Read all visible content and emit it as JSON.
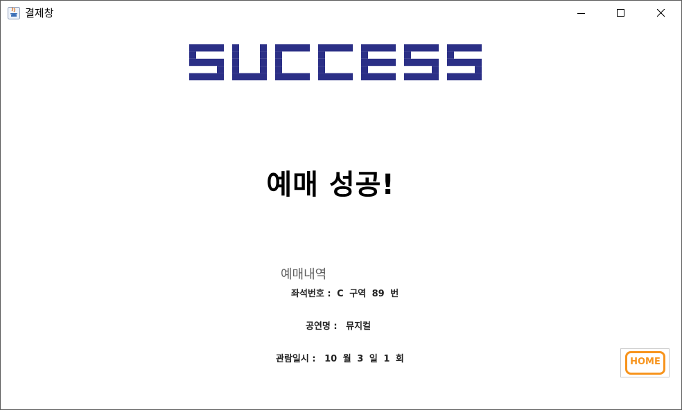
{
  "window": {
    "title": "결제창",
    "controls": [
      "minimize",
      "maximize",
      "close"
    ]
  },
  "banner": {
    "text": "SUCCESS",
    "color": "#2b2f86"
  },
  "headline": "예매 성공!",
  "details": {
    "section_title": "예매내역",
    "seat_label": "좌석번호 :",
    "seat_zone": "C",
    "seat_zone_unit": "구역",
    "seat_number": "89",
    "seat_number_unit": "번",
    "show_label": "공연명 :",
    "show_name": "뮤지컬",
    "date_label": "관람일시 :",
    "month": "10",
    "month_unit": "월",
    "day": "3",
    "day_unit": "일",
    "round": "1",
    "round_unit": "회"
  },
  "home_button": {
    "label": "HOME",
    "color": "#f7941d"
  }
}
